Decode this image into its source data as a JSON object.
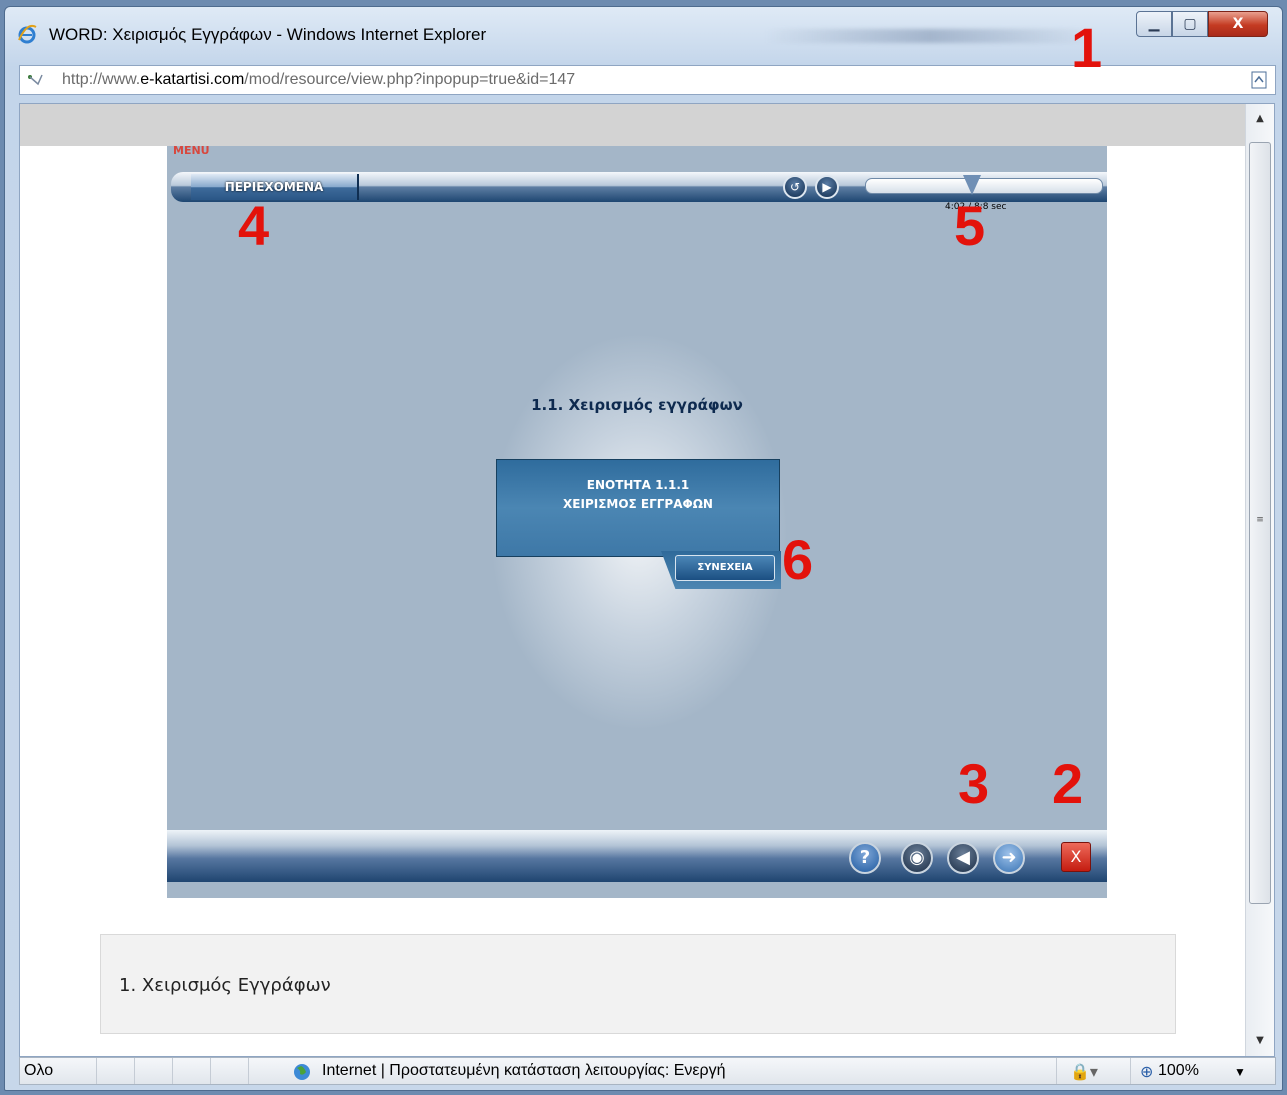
{
  "window": {
    "title": "WORD: Χειρισμός Εγγράφων - Windows Internet Explorer",
    "buttons": {
      "minimize": "▁",
      "maximize": "▢",
      "close": "X"
    }
  },
  "address": {
    "prefix": "http://www.",
    "domain": "e-katartisi.com",
    "path": "/mod/resource/view.php?inpopup=true&id=147"
  },
  "player": {
    "menu_label": "MENU",
    "contents_button": "ΠΕΡΙΕΧΟΜΕΝΑ",
    "time_readout": "4:02 / 8:8 sec",
    "seek_progress": 0.45,
    "section_title": "1.1. Χειρισμός εγγράφων",
    "unit_line1": "ΕΝΟΤΗΤΑ 1.1.1",
    "unit_line2": "ΧΕΙΡΙΣΜΟΣ ΕΓΓΡΑΦΩΝ",
    "continue_button": "ΣΥΝΕΧΕΙΑ",
    "bottom_buttons": {
      "help": "?",
      "close": "X"
    }
  },
  "annotations": [
    "1",
    "2",
    "3",
    "4",
    "5",
    "6"
  ],
  "resource_label": "1. Χειρισμός Εγγράφων",
  "status": {
    "left": "Ολο",
    "zone": "Internet | Προστατευμένη κατάσταση λειτουργίας: Ενεργή",
    "zoom": "100%"
  },
  "colors": {
    "annotation": "#e3120b",
    "player_bg": "#a4b6c8",
    "menu_label": "#d8473d"
  }
}
